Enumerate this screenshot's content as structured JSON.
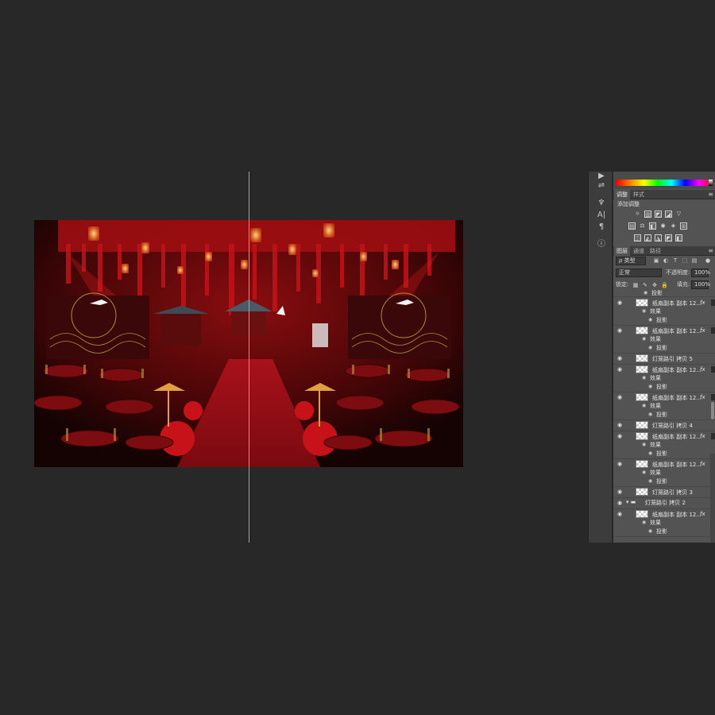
{
  "canvas": {
    "description_icon": "wedding-stage-artwork"
  },
  "toolstrip": {
    "tools": [
      "play-icon",
      "adjust-sliders-icon",
      "brush-preset-icon",
      "type-tool-icon",
      "paragraph-icon",
      "info-icon"
    ],
    "glyphs": [
      "▶",
      "⇌",
      "♆",
      "A|",
      "¶",
      "ⓘ"
    ]
  },
  "adjustments": {
    "tabs": [
      "调整",
      "样式"
    ],
    "title": "添加调整",
    "icons_row1": [
      "☼",
      "▥",
      "◩",
      "◪",
      "▽"
    ],
    "icons_row2": [
      "▤",
      "⚖",
      "◧",
      "◉",
      "◈",
      "⊞"
    ],
    "icons_row3": [
      "◫",
      "◭",
      "◮",
      "◩",
      "◧"
    ]
  },
  "layers_panel": {
    "tabs": [
      "图层",
      "通道",
      "路径"
    ],
    "filter": "ρ 类型",
    "blend_mode": "正常",
    "opacity_label": "不透明度:",
    "opacity_value": "100%",
    "lock_label": "锁定:",
    "fill_label": "填充:",
    "fill_value": "100%",
    "effect_label": "效果",
    "shadow_label": "投影",
    "fx_label": "fx",
    "layers": [
      {
        "name": "投影",
        "type": "effect-only"
      },
      {
        "name": "纸扇副本 副本 12...",
        "fx": true
      },
      {
        "name": "纸扇副本 副本 12...",
        "fx": true
      },
      {
        "name": "灯笼路引 拷贝 5"
      },
      {
        "name": "纸扇副本 副本 12...",
        "fx": true
      },
      {
        "name": "纸扇副本 副本 12...",
        "fx": true
      },
      {
        "name": "灯笼路引 拷贝 4"
      },
      {
        "name": "纸扇副本 副本 12...",
        "fx": true
      },
      {
        "name": "纸扇副本 副本 12...",
        "fx": true
      },
      {
        "name": "灯笼路引 拷贝 3"
      },
      {
        "name": "灯笼路引 拷贝 2",
        "group": true
      },
      {
        "name": "纸扇副本 副本 12...",
        "fx": true
      }
    ]
  },
  "colors": {
    "workspace": "#282828",
    "panel": "#535353",
    "guide": "#45c8d8",
    "stage_red": "#b0141a"
  }
}
